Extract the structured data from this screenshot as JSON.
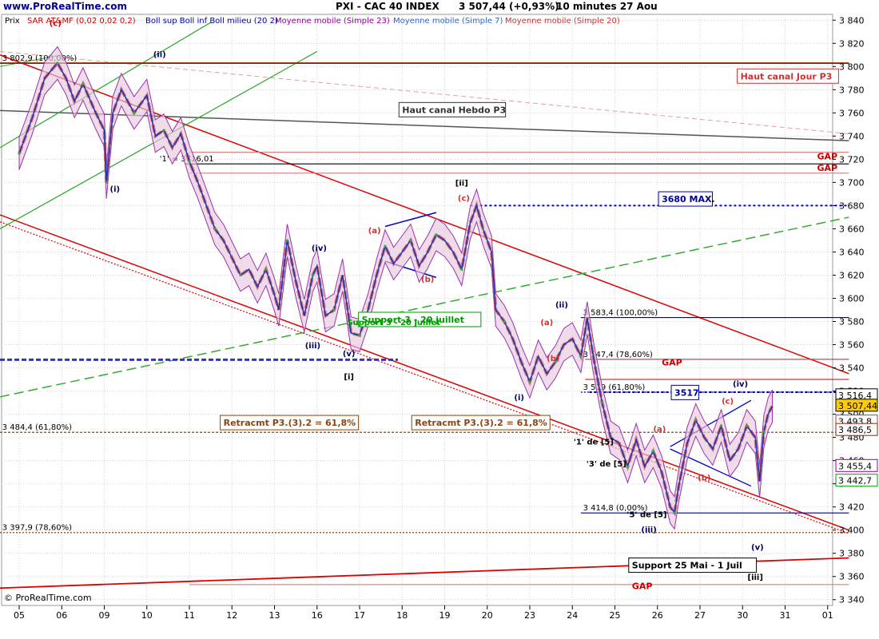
{
  "header": {
    "site": "www.ProRealTime.com",
    "title": "PXI - CAC 40 INDEX",
    "price": "3 507,44 (+0,93%)",
    "timeframe": "10 minutes 27 Aou",
    "price_label": "Prix",
    "copyright": "© ProRealTime.com"
  },
  "indicators": [
    {
      "label": "SAR AT&MF (0,02 0,02 0,2)",
      "color": "#cc0000"
    },
    {
      "label": "Boll sup Boll inf Boll milieu (20 2)",
      "color": "#000099"
    },
    {
      "label": "Moyenne mobile (Simple 23)",
      "color": "#990099"
    },
    {
      "label": "Moyenne mobile (Simple 7)",
      "color": "#3366cc"
    },
    {
      "label": "Moyenne mobile (Simple 20)",
      "color": "#cc3333"
    }
  ],
  "chart_data": {
    "type": "line",
    "title": "PXI - CAC 40 INDEX",
    "ylim": [
      3335,
      3845
    ],
    "y_ticks": [
      3340,
      3360,
      3380,
      3400,
      3420,
      3440,
      3460,
      3480,
      3500,
      3520,
      3540,
      3560,
      3580,
      3600,
      3620,
      3640,
      3660,
      3680,
      3700,
      3720,
      3740,
      3760,
      3780,
      3800,
      3820,
      3840
    ],
    "x_ticks": [
      "05",
      "06",
      "09",
      "10",
      "11",
      "12",
      "13",
      "16",
      "17",
      "18",
      "19",
      "20",
      "23",
      "24",
      "25",
      "26",
      "27",
      "30",
      "31",
      "01"
    ],
    "grid": true,
    "series": [
      {
        "values": [
          [
            0,
            3725
          ],
          [
            0.3,
            3755
          ],
          [
            0.6,
            3790
          ],
          [
            0.9,
            3803
          ],
          [
            1.1,
            3790
          ],
          [
            1.3,
            3770
          ],
          [
            1.5,
            3785
          ],
          [
            1.8,
            3760
          ],
          [
            2.0,
            3745
          ],
          [
            2.05,
            3700
          ],
          [
            2.2,
            3760
          ],
          [
            2.4,
            3780
          ],
          [
            2.7,
            3760
          ],
          [
            3.0,
            3775
          ],
          [
            3.2,
            3740
          ],
          [
            3.4,
            3745
          ],
          [
            3.6,
            3730
          ],
          [
            3.8,
            3742
          ],
          [
            4.0,
            3718
          ],
          [
            4.2,
            3700
          ],
          [
            4.4,
            3680
          ],
          [
            4.6,
            3660
          ],
          [
            4.8,
            3650
          ],
          [
            5.0,
            3635
          ],
          [
            5.2,
            3620
          ],
          [
            5.4,
            3625
          ],
          [
            5.6,
            3610
          ],
          [
            5.8,
            3625
          ],
          [
            6.0,
            3603
          ],
          [
            6.1,
            3590
          ],
          [
            6.3,
            3650
          ],
          [
            6.5,
            3615
          ],
          [
            6.7,
            3585
          ],
          [
            6.9,
            3620
          ],
          [
            7.0,
            3628
          ],
          [
            7.2,
            3585
          ],
          [
            7.4,
            3590
          ],
          [
            7.6,
            3620
          ],
          [
            7.8,
            3570
          ],
          [
            8.0,
            3568
          ],
          [
            8.2,
            3590
          ],
          [
            8.4,
            3620
          ],
          [
            8.6,
            3645
          ],
          [
            8.8,
            3630
          ],
          [
            9.0,
            3640
          ],
          [
            9.2,
            3650
          ],
          [
            9.4,
            3628
          ],
          [
            9.6,
            3640
          ],
          [
            9.8,
            3655
          ],
          [
            10.0,
            3650
          ],
          [
            10.2,
            3640
          ],
          [
            10.4,
            3625
          ],
          [
            10.6,
            3665
          ],
          [
            10.75,
            3680
          ],
          [
            10.9,
            3660
          ],
          [
            11.1,
            3640
          ],
          [
            11.2,
            3590
          ],
          [
            11.4,
            3580
          ],
          [
            11.6,
            3565
          ],
          [
            11.8,
            3545
          ],
          [
            12.0,
            3528
          ],
          [
            12.2,
            3550
          ],
          [
            12.4,
            3535
          ],
          [
            12.6,
            3545
          ],
          [
            12.8,
            3560
          ],
          [
            13.0,
            3565
          ],
          [
            13.2,
            3550
          ],
          [
            13.35,
            3583
          ],
          [
            13.5,
            3548
          ],
          [
            13.7,
            3510
          ],
          [
            13.9,
            3480
          ],
          [
            14.1,
            3475
          ],
          [
            14.3,
            3455
          ],
          [
            14.5,
            3478
          ],
          [
            14.7,
            3455
          ],
          [
            14.9,
            3468
          ],
          [
            15.1,
            3450
          ],
          [
            15.3,
            3420
          ],
          [
            15.4,
            3415
          ],
          [
            15.5,
            3438
          ],
          [
            15.7,
            3475
          ],
          [
            15.9,
            3495
          ],
          [
            16.1,
            3480
          ],
          [
            16.3,
            3470
          ],
          [
            16.5,
            3490
          ],
          [
            16.7,
            3460
          ],
          [
            16.9,
            3470
          ],
          [
            17.1,
            3490
          ],
          [
            17.3,
            3480
          ],
          [
            17.4,
            3442
          ],
          [
            17.5,
            3485
          ],
          [
            17.6,
            3500
          ],
          [
            17.7,
            3507
          ]
        ]
      }
    ],
    "levels": [
      {
        "label": "3 802,9 (100,00%)",
        "value": 3802.9,
        "color": "#8b2500"
      },
      {
        "label": "3 583,4 (100,00%)",
        "value": 3583.4,
        "color": "#000099"
      },
      {
        "label": "3 547,4 (78,60%)",
        "value": 3547.4,
        "color": "#cc3333"
      },
      {
        "label": "3 519 (61,80%)",
        "value": 3519,
        "color": "#000099"
      },
      {
        "label": "3 484,4 (61,80%)",
        "value": 3484.4,
        "color": "#8b4513"
      },
      {
        "label": "3 414,8 (0,00%)",
        "value": 3414.8,
        "color": "#000099"
      },
      {
        "label": "3 397,9 (78,60%)",
        "value": 3397.9,
        "color": "#8b4513"
      },
      {
        "label": "'1' = 3716,01",
        "value": 3716,
        "color": "#000000"
      }
    ],
    "annotations": [
      {
        "text": "Haut canal Hebdo P3",
        "color": "#333333"
      },
      {
        "text": "Haut canal Jour P3",
        "color": "#cc3333"
      },
      {
        "text": "3680 MAX.",
        "color": "#000099"
      },
      {
        "text": "Support 3 - 20 juillet",
        "color": "#009900"
      },
      {
        "text": "Retracmt P3.(3).2 = 61,8%",
        "color": "#8b4513"
      },
      {
        "text": "Retracmt P3.(3).2 = 61,8%",
        "color": "#8b4513"
      },
      {
        "text": "3517",
        "color": "#000099"
      },
      {
        "text": "GAP",
        "color": "#cc0000"
      },
      {
        "text": "GAP",
        "color": "#cc0000"
      },
      {
        "text": "GAP",
        "color": "#cc0000"
      },
      {
        "text": "GAP",
        "color": "#cc0000"
      },
      {
        "text": "Support 25 Mai - 1 Juil",
        "color": "#000000"
      }
    ],
    "price_badges": [
      {
        "text": "3 516,4",
        "value": 3516.4,
        "color": "#000000"
      },
      {
        "text": "3 507,44",
        "value": 3507.44,
        "color": "#000000",
        "highlight": true
      },
      {
        "text": "3 493,8",
        "value": 3493.8,
        "color": "#cc3333"
      },
      {
        "text": "3 486,5",
        "value": 3486.5,
        "color": "#8b2500"
      },
      {
        "text": "3 455,4",
        "value": 3455.4,
        "color": "#990099"
      },
      {
        "text": "3 442,7",
        "value": 3442.7,
        "color": "#009900"
      }
    ],
    "wave_labels": [
      {
        "text": "(c)",
        "x": 0.85,
        "y": 3835,
        "color": "#cc0000"
      },
      {
        "text": "(i)",
        "x": 2.25,
        "y": 3692,
        "color": "#000066"
      },
      {
        "text": "(ii)",
        "x": 3.3,
        "y": 3808,
        "color": "#000066"
      },
      {
        "text": "(iv)",
        "x": 7.05,
        "y": 3641,
        "color": "#000066"
      },
      {
        "text": "(iii)",
        "x": 6.9,
        "y": 3557,
        "color": "#000066"
      },
      {
        "text": "(v)",
        "x": 7.75,
        "y": 3550,
        "color": "#000066"
      },
      {
        "text": "[i]",
        "x": 7.75,
        "y": 3530,
        "color": "#000000"
      },
      {
        "text": "[ii]",
        "x": 10.4,
        "y": 3697,
        "color": "#000000"
      },
      {
        "text": "(a)",
        "x": 8.35,
        "y": 3656,
        "color": "#cc3333"
      },
      {
        "text": "(b)",
        "x": 9.6,
        "y": 3614,
        "color": "#cc3333"
      },
      {
        "text": "(c)",
        "x": 10.45,
        "y": 3684,
        "color": "#cc3333"
      },
      {
        "text": "(i)",
        "x": 11.75,
        "y": 3512,
        "color": "#000066"
      },
      {
        "text": "(ii)",
        "x": 12.75,
        "y": 3592,
        "color": "#000066"
      },
      {
        "text": "(a)",
        "x": 12.4,
        "y": 3577,
        "color": "#cc3333"
      },
      {
        "text": "(b)",
        "x": 12.55,
        "y": 3546,
        "color": "#cc3333"
      },
      {
        "text": "(iii)",
        "x": 14.8,
        "y": 3398,
        "color": "#000066"
      },
      {
        "text": "(a)",
        "x": 15.05,
        "y": 3485,
        "color": "#cc3333"
      },
      {
        "text": "(b)",
        "x": 16.1,
        "y": 3443,
        "color": "#cc3333"
      },
      {
        "text": "(c)",
        "x": 16.65,
        "y": 3509,
        "color": "#cc3333"
      },
      {
        "text": "(iv)",
        "x": 16.95,
        "y": 3524,
        "color": "#000066"
      },
      {
        "text": "(v)",
        "x": 17.35,
        "y": 3383,
        "color": "#000066"
      },
      {
        "text": "[iii]",
        "x": 17.3,
        "y": 3357,
        "color": "#000000"
      },
      {
        "text": "'3' de [5]",
        "x": 13.8,
        "y": 3455,
        "color": "#000000"
      },
      {
        "text": "'5' de [5]",
        "x": 14.75,
        "y": 3411,
        "color": "#000000"
      },
      {
        "text": "'1' de [5]",
        "x": 13.5,
        "y": 3474,
        "color": "#000000"
      },
      {
        "text": "Support 3 - 20 juillet",
        "x": 8.8,
        "y": 3577,
        "color": "#009900"
      }
    ]
  }
}
